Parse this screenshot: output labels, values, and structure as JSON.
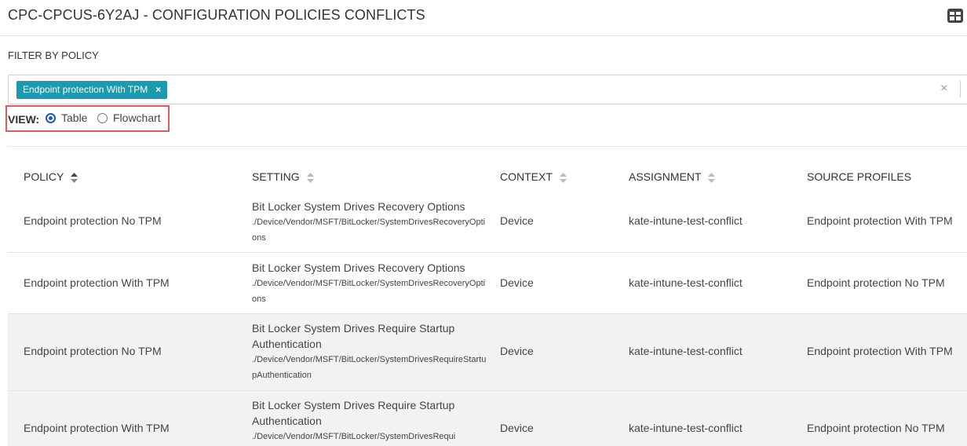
{
  "header": {
    "title": "CPC-CPCUS-6Y2AJ - CONFIGURATION POLICIES CONFLICTS",
    "layout_icon": "table-layout-icon"
  },
  "filter": {
    "label": "FILTER BY POLICY",
    "chips": [
      {
        "label": "Endpoint protection With TPM",
        "remove_glyph": "×"
      }
    ],
    "clear_glyph": "×"
  },
  "view": {
    "label": "VIEW:",
    "options": [
      {
        "label": "Table",
        "selected": true
      },
      {
        "label": "Flowchart",
        "selected": false
      }
    ]
  },
  "table": {
    "columns": [
      "POLICY",
      "SETTING",
      "CONTEXT",
      "ASSIGNMENT",
      "SOURCE PROFILES"
    ],
    "rows": [
      {
        "policy": "Endpoint protection No TPM",
        "setting_name": "Bit Locker System Drives Recovery Options",
        "setting_path": "./Device/Vendor/MSFT/BitLocker/SystemDrivesRecoveryOptions",
        "context": "Device",
        "assignment": "kate-intune-test-conflict",
        "source_profiles": "Endpoint protection With TPM"
      },
      {
        "policy": "Endpoint protection With TPM",
        "setting_name": "Bit Locker System Drives Recovery Options",
        "setting_path": "./Device/Vendor/MSFT/BitLocker/SystemDrivesRecoveryOptions",
        "context": "Device",
        "assignment": "kate-intune-test-conflict",
        "source_profiles": "Endpoint protection No TPM"
      },
      {
        "policy": "Endpoint protection No TPM",
        "setting_name": "Bit Locker System Drives Require Startup Authentication",
        "setting_path": "./Device/Vendor/MSFT/BitLocker/SystemDrivesRequireStartupAuthentication",
        "context": "Device",
        "assignment": "kate-intune-test-conflict",
        "source_profiles": "Endpoint protection With TPM"
      },
      {
        "policy": "Endpoint protection With TPM",
        "setting_name": "Bit Locker System Drives Require Startup Authentication",
        "setting_path": "./Device/Vendor/MSFT/BitLocker/SystemDrivesRequi",
        "context": "Device",
        "assignment": "kate-intune-test-conflict",
        "source_profiles": "Endpoint protection No TPM"
      }
    ]
  },
  "colors": {
    "chip": "#1a9cb0",
    "highlight_border": "#e15a5a",
    "radio_selected": "#1f5ba8",
    "row_shade": "#f2f2f2"
  }
}
